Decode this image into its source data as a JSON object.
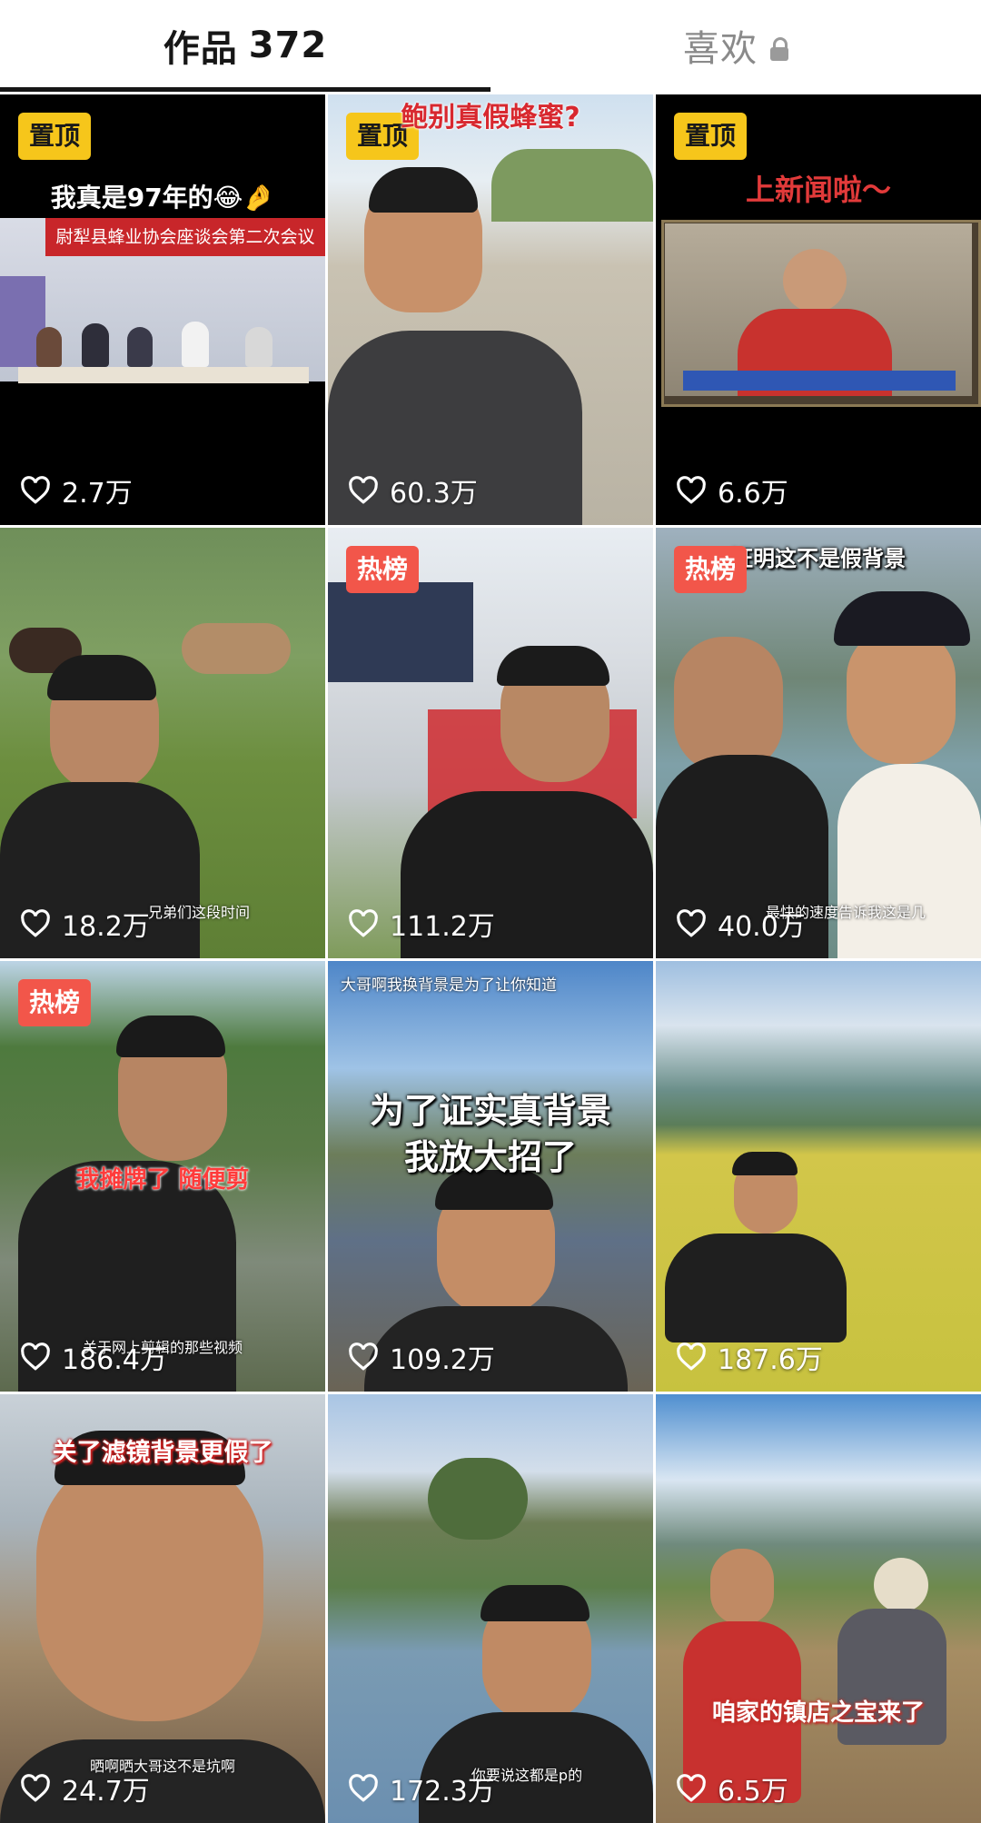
{
  "tabs": {
    "works_label": "作品",
    "works_count": "372",
    "likes_label": "喜欢",
    "likes_icon": "lock-icon"
  },
  "colors": {
    "pin_badge": "#f6c61b",
    "hot_badge": "#f2564a",
    "indicator": "#161616"
  },
  "videos": [
    {
      "badge": "置顶",
      "overlay": "我真是97年的😂🤌",
      "banner": "尉犁县蜂业协会座谈会第二次会议",
      "caption": "",
      "likes": "2.7万"
    },
    {
      "badge": "置顶",
      "overlay": "鲍别真假蜂蜜?",
      "caption": "",
      "likes": "60.3万"
    },
    {
      "badge": "置顶",
      "overlay": "上新闻啦～",
      "caption": "",
      "likes": "6.6万"
    },
    {
      "badge": "",
      "overlay": "",
      "caption": "兄弟们这段时间",
      "likes": "18.2万"
    },
    {
      "badge": "热榜",
      "overlay": "",
      "caption": "",
      "likes": "111.2万"
    },
    {
      "badge": "热榜",
      "overlay": "证明这不是假背景",
      "caption": "最快的速度告诉我这是几",
      "likes": "40.0万"
    },
    {
      "badge": "热榜",
      "overlay": "我摊牌了 随便剪",
      "caption": "关于网上剪辑的那些视频",
      "likes": "186.4万"
    },
    {
      "badge": "",
      "overlay": "为了证实真背景\n我放大招了",
      "top_caption": "大哥啊我换背景是为了让你知道",
      "caption": "",
      "likes": "109.2万"
    },
    {
      "badge": "",
      "overlay": "",
      "caption": "",
      "likes": "187.6万"
    },
    {
      "badge": "",
      "overlay": "关了滤镜背景更假了",
      "caption": "晒啊晒大哥这不是坑啊",
      "likes": "24.7万"
    },
    {
      "badge": "",
      "overlay": "",
      "caption": "你要说这都是p的",
      "likes": "172.3万"
    },
    {
      "badge": "",
      "overlay": "咱家的镇店之宝来了",
      "caption": "",
      "likes": "6.5万"
    }
  ]
}
